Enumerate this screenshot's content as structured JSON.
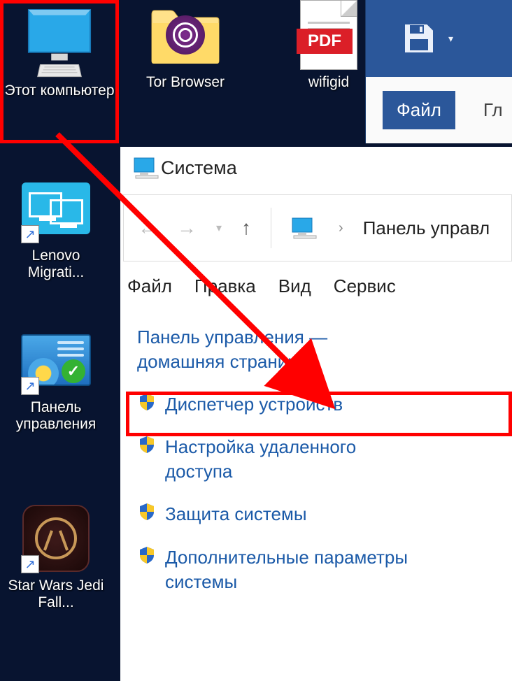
{
  "desktop_icons": {
    "this_pc": "Этот компьютер",
    "tor": "Tor Browser",
    "wifigid": "wifigid",
    "pdf_badge": "PDF",
    "lenovo": "Lenovo Migrati...",
    "panel": "Панель управления",
    "starwars": "Star Wars Jedi Fall..."
  },
  "word": {
    "file_tab": "Файл",
    "other_tab": "Гл"
  },
  "system": {
    "title": "Система",
    "nav": {
      "breadcrumb": "Панель управл"
    },
    "menu": {
      "file": "Файл",
      "edit": "Правка",
      "view": "Вид",
      "service": "Сервис"
    },
    "links": {
      "home1": "Панель управления —",
      "home2": "домашняя страница",
      "device_manager": "Диспетчер устройств",
      "remote1": "Настройка удаленного",
      "remote2": "доступа",
      "protection": "Защита системы",
      "advanced1": "Дополнительные параметры",
      "advanced2": "системы"
    }
  }
}
